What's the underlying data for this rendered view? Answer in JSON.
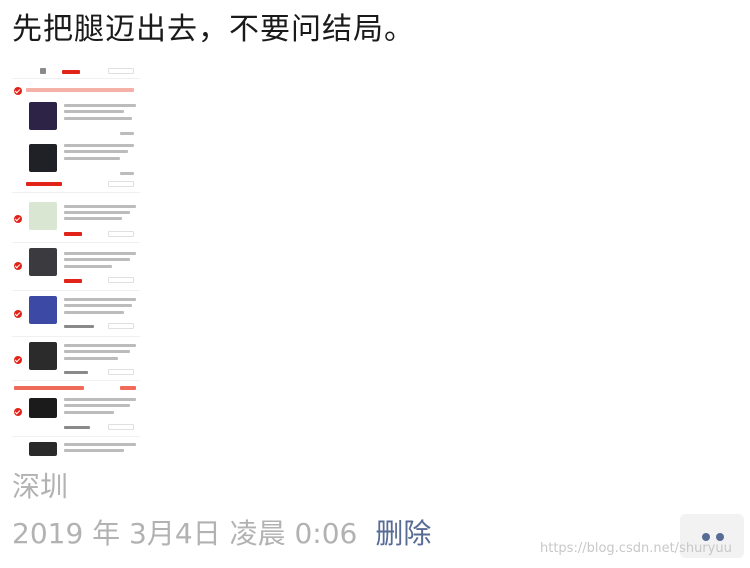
{
  "post": {
    "text": "先把腿迈出去，不要问结局。"
  },
  "location": "深圳",
  "meta": {
    "timestamp": "2019 年 3月4日 凌晨 0:06",
    "delete_label": "删除"
  },
  "more_button": {
    "icon": "more-dots-icon"
  },
  "watermark": "https://blog.csdn.net/shuryuu",
  "colors": {
    "link": "#576b95",
    "meta_gray": "#b2b2b2",
    "check_red": "#e2231a"
  }
}
